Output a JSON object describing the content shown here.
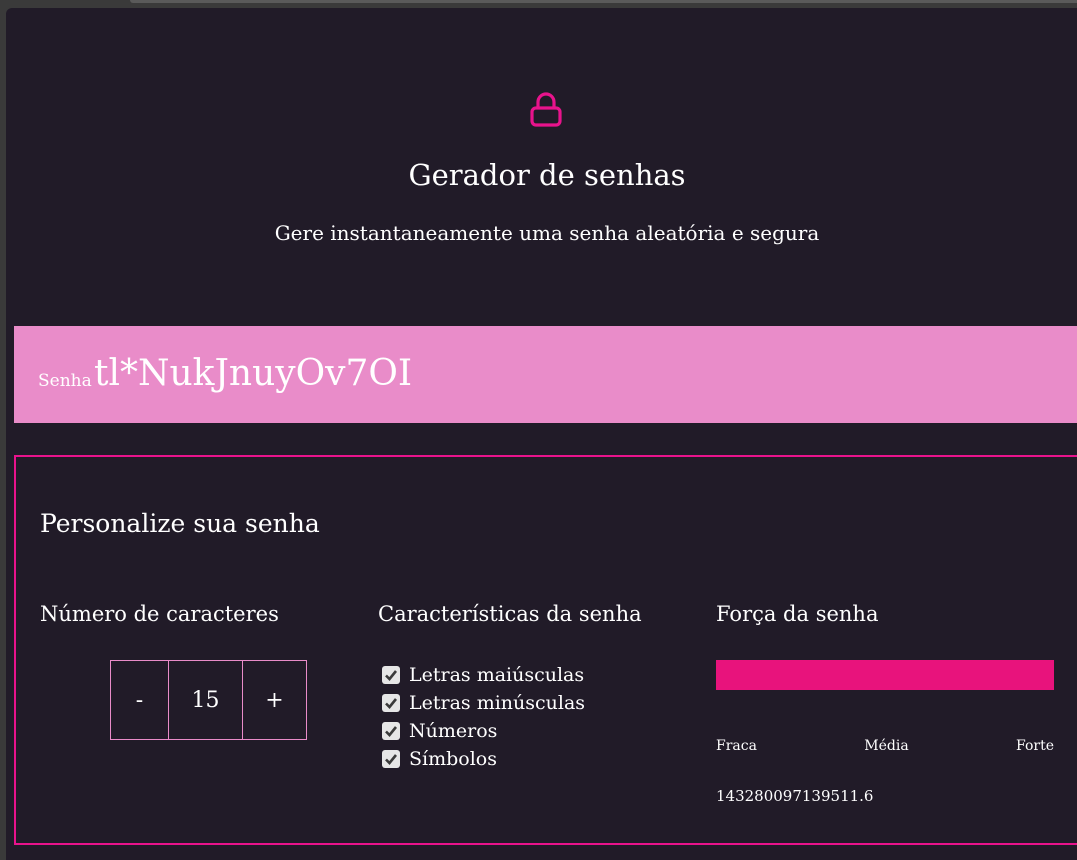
{
  "header": {
    "icon": "lock-icon",
    "title": "Gerador de senhas",
    "subtitle": "Gere instantaneamente uma senha aleatória e segura"
  },
  "password": {
    "label": "Senha",
    "value": "tl*NukJnuyOv7OI"
  },
  "customize": {
    "title": "Personalize sua senha",
    "length": {
      "heading": "Número de caracteres",
      "decrement_label": "-",
      "value": "15",
      "increment_label": "+"
    },
    "features": {
      "heading": "Características da senha",
      "options": [
        {
          "label": "Letras maiúsculas",
          "checked": true
        },
        {
          "label": "Letras minúsculas",
          "checked": true
        },
        {
          "label": "Números",
          "checked": true
        },
        {
          "label": "Símbolos",
          "checked": true
        }
      ]
    },
    "strength": {
      "heading": "Força da senha",
      "fill": 1.0,
      "labels": [
        "Fraca",
        "Média",
        "Forte"
      ],
      "score": "143280097139511.6"
    }
  },
  "colors": {
    "background": "#211b28",
    "accent": "#e8138c",
    "password_bar": "#e98cc9",
    "strength_fill": "#e8137c"
  }
}
